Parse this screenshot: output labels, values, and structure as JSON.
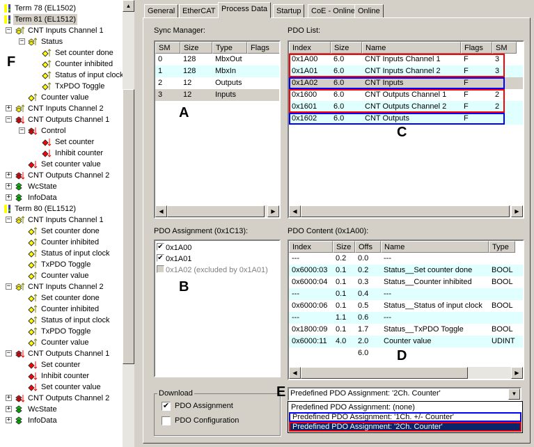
{
  "tree": {
    "items": [
      {
        "label": "Term 78 (EL1502)",
        "level": 0,
        "icon": "term",
        "exp": ""
      },
      {
        "label": "Term 81 (EL1512)",
        "level": 0,
        "icon": "term",
        "exp": "",
        "selected": true
      },
      {
        "label": "CNT Inputs Channel 1",
        "level": 1,
        "icon": "in-group",
        "exp": "-"
      },
      {
        "label": "Status",
        "level": 2,
        "icon": "in-group",
        "exp": "-"
      },
      {
        "label": "Set counter done",
        "level": 3,
        "icon": "in",
        "exp": ""
      },
      {
        "label": "Counter inhibited",
        "level": 3,
        "icon": "in",
        "exp": ""
      },
      {
        "label": "Status of input clock",
        "level": 3,
        "icon": "in",
        "exp": ""
      },
      {
        "label": "TxPDO Toggle",
        "level": 3,
        "icon": "in",
        "exp": ""
      },
      {
        "label": "Counter value",
        "level": 2,
        "icon": "in",
        "exp": ""
      },
      {
        "label": "CNT Inputs Channel 2",
        "level": 1,
        "icon": "in-group",
        "exp": "+"
      },
      {
        "label": "CNT Outputs Channel 1",
        "level": 1,
        "icon": "out-group",
        "exp": "-"
      },
      {
        "label": "Control",
        "level": 2,
        "icon": "out-group",
        "exp": "-"
      },
      {
        "label": "Set counter",
        "level": 3,
        "icon": "out",
        "exp": ""
      },
      {
        "label": "Inhibit counter",
        "level": 3,
        "icon": "out",
        "exp": ""
      },
      {
        "label": "Set counter value",
        "level": 2,
        "icon": "out",
        "exp": ""
      },
      {
        "label": "CNT Outputs Channel 2",
        "level": 1,
        "icon": "out-group",
        "exp": "+"
      },
      {
        "label": "WcState",
        "level": 1,
        "icon": "green",
        "exp": "+"
      },
      {
        "label": "InfoData",
        "level": 1,
        "icon": "green",
        "exp": "+"
      },
      {
        "label": "Term 80 (EL1512)",
        "level": 0,
        "icon": "term",
        "exp": ""
      },
      {
        "label": "CNT Inputs Channel 1",
        "level": 1,
        "icon": "in-group",
        "exp": "-"
      },
      {
        "label": "Set counter done",
        "level": 2,
        "icon": "in",
        "exp": ""
      },
      {
        "label": "Counter inhibited",
        "level": 2,
        "icon": "in",
        "exp": ""
      },
      {
        "label": "Status of input clock",
        "level": 2,
        "icon": "in",
        "exp": ""
      },
      {
        "label": "TxPDO Toggle",
        "level": 2,
        "icon": "in",
        "exp": ""
      },
      {
        "label": "Counter value",
        "level": 2,
        "icon": "in",
        "exp": ""
      },
      {
        "label": "CNT Inputs Channel 2",
        "level": 1,
        "icon": "in-group",
        "exp": "-"
      },
      {
        "label": "Set counter done",
        "level": 2,
        "icon": "in",
        "exp": ""
      },
      {
        "label": "Counter inhibited",
        "level": 2,
        "icon": "in",
        "exp": ""
      },
      {
        "label": "Status of input clock",
        "level": 2,
        "icon": "in",
        "exp": ""
      },
      {
        "label": "TxPDO Toggle",
        "level": 2,
        "icon": "in",
        "exp": ""
      },
      {
        "label": "Counter value",
        "level": 2,
        "icon": "in",
        "exp": ""
      },
      {
        "label": "CNT Outputs Channel 1",
        "level": 1,
        "icon": "out-group",
        "exp": "-"
      },
      {
        "label": "Set counter",
        "level": 2,
        "icon": "out",
        "exp": ""
      },
      {
        "label": "Inhibit counter",
        "level": 2,
        "icon": "out",
        "exp": ""
      },
      {
        "label": "Set counter value",
        "level": 2,
        "icon": "out",
        "exp": ""
      },
      {
        "label": "CNT Outputs Channel 2",
        "level": 1,
        "icon": "out-group",
        "exp": "+"
      },
      {
        "label": "WcState",
        "level": 1,
        "icon": "green",
        "exp": "+"
      },
      {
        "label": "InfoData",
        "level": 1,
        "icon": "green",
        "exp": "+"
      }
    ]
  },
  "tabs": [
    "General",
    "EtherCAT",
    "Process Data",
    "Startup",
    "CoE - Online",
    "Online"
  ],
  "active_tab": "Process Data",
  "sync_manager": {
    "label": "Sync Manager:",
    "columns": [
      "SM",
      "Size",
      "Type",
      "Flags"
    ],
    "rows": [
      [
        "0",
        "128",
        "MbxOut",
        ""
      ],
      [
        "1",
        "128",
        "MbxIn",
        ""
      ],
      [
        "2",
        "12",
        "Outputs",
        ""
      ],
      [
        "3",
        "12",
        "Inputs",
        ""
      ]
    ]
  },
  "pdo_list": {
    "label": "PDO List:",
    "columns": [
      "Index",
      "Size",
      "Name",
      "Flags",
      "SM"
    ],
    "rows": [
      [
        "0x1A00",
        "6.0",
        "CNT Inputs Channel 1",
        "F",
        "3"
      ],
      [
        "0x1A01",
        "6.0",
        "CNT Inputs Channel 2",
        "F",
        "3"
      ],
      [
        "0x1A02",
        "6.0",
        "CNT Inputs",
        "F",
        ""
      ],
      [
        "0x1600",
        "6.0",
        "CNT Outputs Channel 1",
        "F",
        "2"
      ],
      [
        "0x1601",
        "6.0",
        "CNT Outputs Channel 2",
        "F",
        "2"
      ],
      [
        "0x1602",
        "6.0",
        "CNT Outputs",
        "F",
        ""
      ]
    ]
  },
  "pdo_assignment": {
    "label": "PDO Assignment (0x1C13):",
    "items": [
      {
        "label": "0x1A00",
        "checked": true,
        "enabled": true
      },
      {
        "label": "0x1A01",
        "checked": true,
        "enabled": true
      },
      {
        "label": "0x1A02 (excluded by 0x1A01)",
        "checked": false,
        "enabled": false
      }
    ]
  },
  "pdo_content": {
    "label": "PDO Content (0x1A00):",
    "columns": [
      "Index",
      "Size",
      "Offs",
      "Name",
      "Type"
    ],
    "rows": [
      [
        "---",
        "0.2",
        "0.0",
        "---",
        ""
      ],
      [
        "0x6000:03",
        "0.1",
        "0.2",
        "Status__Set counter done",
        "BOOL"
      ],
      [
        "0x6000:04",
        "0.1",
        "0.3",
        "Status__Counter inhibited",
        "BOOL"
      ],
      [
        "---",
        "0.1",
        "0.4",
        "---",
        ""
      ],
      [
        "0x6000:06",
        "0.1",
        "0.5",
        "Status__Status of input clock",
        "BOOL"
      ],
      [
        "---",
        "1.1",
        "0.6",
        "---",
        ""
      ],
      [
        "0x1800:09",
        "0.1",
        "1.7",
        "Status__TxPDO Toggle",
        "BOOL"
      ],
      [
        "0x6000:11",
        "4.0",
        "2.0",
        "Counter value",
        "UDINT"
      ],
      [
        "",
        "",
        "6.0",
        "",
        ""
      ]
    ]
  },
  "download": {
    "label": "Download",
    "pdo_assignment": "PDO Assignment",
    "pdo_assignment_checked": true,
    "pdo_configuration": "PDO Configuration",
    "pdo_configuration_checked": false
  },
  "predefined": {
    "selected": "Predefined PDO Assignment: '2Ch. Counter'",
    "options": [
      "Predefined PDO Assignment: (none)",
      "Predefined PDO Assignment: '1Ch. +/- Counter'",
      "Predefined PDO Assignment: '2Ch. Counter'"
    ]
  },
  "annotations": {
    "a": "A",
    "b": "B",
    "c": "C",
    "d": "D",
    "e": "E",
    "f": "F"
  },
  "colors": {
    "highlight_red": "#ff0000",
    "highlight_blue": "#0000ff",
    "selection": "#0a246a",
    "row_alt": "#e0ffff"
  }
}
